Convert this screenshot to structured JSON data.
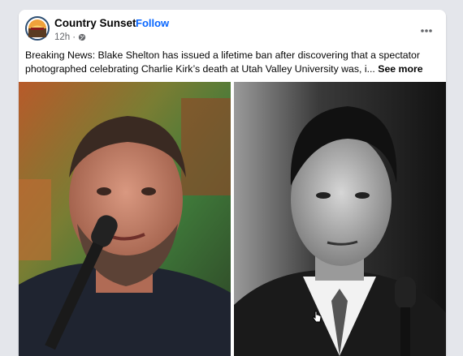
{
  "post": {
    "page_name": "Country Sunset",
    "separator": "·",
    "follow_label": "Follow",
    "timestamp": "12h",
    "meta_separator": "·",
    "privacy_icon": "globe-icon",
    "more_icon": "more-horizontal-icon",
    "text": "Breaking News: Blake Shelton has issued a lifetime ban after discovering that a spectator photographed celebrating Charlie Kirk’s death at Utah Valley University was, i...",
    "see_more_label": "See more"
  },
  "media": {
    "left_image": "photo-singer-with-microphone",
    "right_image": "photo-man-black-and-white"
  },
  "colors": {
    "follow_blue": "#0866ff",
    "text_dark": "#050505",
    "meta_gray": "#65676b",
    "page_background": "#e4e6eb"
  }
}
